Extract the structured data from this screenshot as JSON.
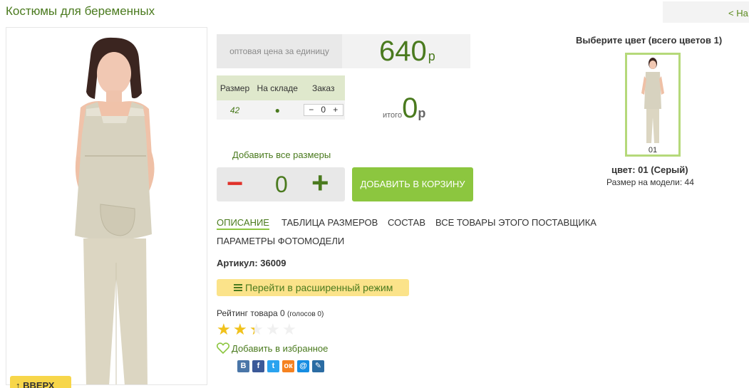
{
  "page": {
    "title": "Костюмы для беременных",
    "back_label": "< На"
  },
  "gallery": {
    "scroll_up_label": "↑ ВВЕРХ"
  },
  "price": {
    "label": "оптовая цена за единицу",
    "value": "640",
    "currency": "р"
  },
  "size_table": {
    "headers": [
      "Размер",
      "На складе",
      "Заказ"
    ],
    "rows": [
      {
        "size": "42",
        "in_stock": "●",
        "qty": "0"
      }
    ],
    "minus": "−",
    "plus": "+"
  },
  "total": {
    "label": "итого",
    "value": "0",
    "currency": "р"
  },
  "order": {
    "add_all_label": "Добавить все размеры",
    "minus": "−",
    "qty": "0",
    "plus": "+",
    "cart_button": "ДОБАВИТЬ В КОРЗИНУ"
  },
  "tabs": [
    {
      "label": "ОПИСАНИЕ",
      "active": true
    },
    {
      "label": "ТАБЛИЦА РАЗМЕРОВ",
      "active": false
    },
    {
      "label": "СОСТАВ",
      "active": false
    },
    {
      "label": "ВСЕ ТОВАРЫ ЭТОГО ПОСТАВЩИКА",
      "active": false
    },
    {
      "label": "ПАРАМЕТРЫ ФОТОМОДЕЛИ",
      "active": false
    }
  ],
  "product": {
    "sku": "Артикул: 36009",
    "advanced_mode": "Перейти в расширенный режим",
    "rating_text": "Рейтинг товара 0",
    "rating_votes": "(голосов 0)",
    "rating_stars_value": 2.3,
    "rating_stars_max": 5,
    "wishlist": "Добавить в избранное"
  },
  "social": [
    {
      "name": "vkontakte-icon",
      "glyph": "В",
      "color": "#4a76a8"
    },
    {
      "name": "facebook-icon",
      "glyph": "f",
      "color": "#3b5998"
    },
    {
      "name": "twitter-icon",
      "glyph": "t",
      "color": "#2aa3ef"
    },
    {
      "name": "odnoklassniki-icon",
      "glyph": "ок",
      "color": "#f58220"
    },
    {
      "name": "mailru-icon",
      "glyph": "@",
      "color": "#168de2"
    },
    {
      "name": "livejournal-icon",
      "glyph": "✎",
      "color": "#2b6ca3"
    }
  ],
  "colors": {
    "heading": "Выберите цвет (всего цветов 1)",
    "thumb_label": "01",
    "selected_name": "цвет: 01 (Серый)",
    "model_size": "Размер на модели: 44"
  },
  "theme": {
    "accent_green": "#4a7a1e",
    "button_green": "#8cc63f",
    "minus_red": "#e0312a",
    "star_gold": "#f1c21b",
    "highlight_yellow": "#fbe38a"
  }
}
